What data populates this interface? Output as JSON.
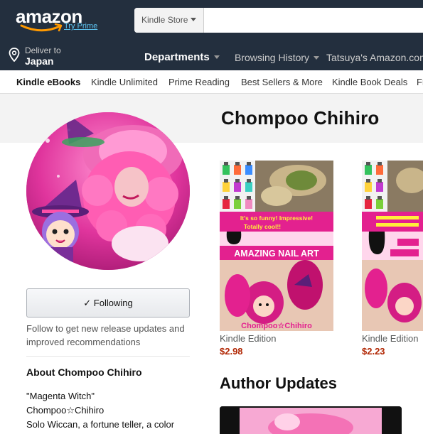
{
  "header": {
    "logo_text": "amazon",
    "try_prime": "Try Prime",
    "search_category": "Kindle Store",
    "search_placeholder": "",
    "deliver_label": "Deliver to",
    "deliver_country": "Japan",
    "departments": "Departments",
    "browsing_history": "Browsing History",
    "account_link": "Tatsuya's Amazon.com"
  },
  "subnav": {
    "items": [
      "Kindle eBooks",
      "Kindle Unlimited",
      "Prime Reading",
      "Best Sellers & More",
      "Kindle Book Deals",
      "Fr"
    ]
  },
  "author": {
    "name": "Chompoo Chihiro",
    "follow_button": "✓ Following",
    "follow_text": "Follow to get new release updates and improved recommendations",
    "about_heading": "About Chompoo Chihiro",
    "bio_lines": [
      "\"Magenta Witch\"",
      "Chompoo☆Chihiro",
      "Solo Wiccan, a fortune teller, a color"
    ]
  },
  "books": [
    {
      "cover_banner": "It's so funny! Impressive! Totally cool!!",
      "cover_title": "AMAZING NAIL ART",
      "cover_author": "Chompoo☆Chihiro",
      "format": "Kindle Edition",
      "price": "$2.98"
    },
    {
      "cover_banner": "",
      "cover_title": "",
      "cover_author": "",
      "format": "Kindle Edition",
      "price": "$2.23"
    }
  ],
  "updates": {
    "heading": "Author Updates"
  },
  "colors": {
    "nav_bg": "#232f3e",
    "prime_blue": "#5dc3f0",
    "price_red": "#b12704",
    "logo_orange": "#ff9900",
    "magenta": "#e3218f"
  }
}
